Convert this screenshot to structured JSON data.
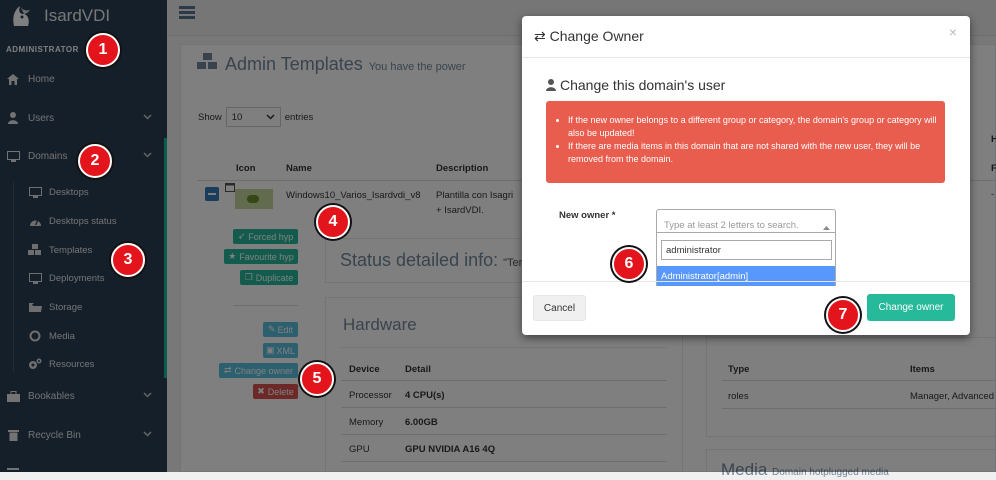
{
  "app": {
    "name": "IsardVDI",
    "role_label": "ADMINISTRATOR"
  },
  "sidebar": {
    "items": [
      {
        "label": "Home",
        "icon": "home-icon"
      },
      {
        "label": "Users",
        "icon": "user-icon"
      },
      {
        "label": "Domains",
        "icon": "desktop-icon"
      },
      {
        "label": "Bookables",
        "icon": "briefcase-icon"
      },
      {
        "label": "Recycle Bin",
        "icon": "trash-icon"
      }
    ],
    "domains_sub": [
      {
        "label": "Desktops",
        "icon": "desktop-icon"
      },
      {
        "label": "Desktops status",
        "icon": "dashboard-icon"
      },
      {
        "label": "Templates",
        "icon": "cubes-icon"
      },
      {
        "label": "Deployments",
        "icon": "desktop-icon"
      },
      {
        "label": "Storage",
        "icon": "folder-icon"
      },
      {
        "label": "Media",
        "icon": "circle-icon"
      },
      {
        "label": "Resources",
        "icon": "cogs-icon"
      }
    ]
  },
  "page": {
    "title": "Admin Templates",
    "subtitle": "You have the power",
    "show_label": "Show",
    "entries_value": "10",
    "entries_label": "entries",
    "columns": {
      "icon": "Icon",
      "name": "Name",
      "description": "Description"
    },
    "row": {
      "name": "Windows10_Varios_Isardvdi_v8",
      "description": "Plantilla con Isagri + IsardVDI. Usuario: is"
    },
    "actions": {
      "forced_hyp": "Forced hyp",
      "favourite_hyp": "Favourite hyp",
      "duplicate": "Duplicate",
      "edit": "Edit",
      "xml": "XML",
      "change_owner": "Change owner",
      "delete": "Delete"
    },
    "status_title": "Status detailed info:",
    "status_value": "\"Ter",
    "hardware": {
      "title": "Hardware",
      "headers": [
        "Device",
        "Detail"
      ],
      "rows": [
        [
          "Processor",
          "4 CPU(s)"
        ],
        [
          "Memory",
          "6.00GB"
        ],
        [
          "GPU",
          "GPU NVIDIA A16 4Q"
        ]
      ]
    },
    "allowed": {
      "headers": [
        "Type",
        "Items"
      ],
      "rows": [
        [
          "roles",
          "Manager, Advanced"
        ]
      ]
    },
    "media": {
      "title": "Media",
      "subtitle": "Domain hotplugged media"
    },
    "right_col_fragments": [
      "H",
      "F",
      "-"
    ]
  },
  "modal": {
    "title": "Change Owner",
    "close_label": "×",
    "section_title": "Change this domain's user",
    "alerts": [
      "If the new owner belongs to a different group or category, the domain's group or category will also be updated!",
      "If there are media items in this domain that are not shared with the new user, they will be removed from the domain."
    ],
    "new_owner_label": "New owner *",
    "select_placeholder": "Type at least 2 letters to search.",
    "search_value": "administrator",
    "option": "Administrator[admin]",
    "cancel_label": "Cancel",
    "submit_label": "Change owner"
  },
  "callouts": [
    "1",
    "2",
    "3",
    "4",
    "5",
    "6",
    "7"
  ],
  "colors": {
    "sidebar": "#2a3f54",
    "accent": "#26b99a",
    "alert": "#e74c3c",
    "highlight": "#5897fb",
    "callout": "#e3141b"
  }
}
